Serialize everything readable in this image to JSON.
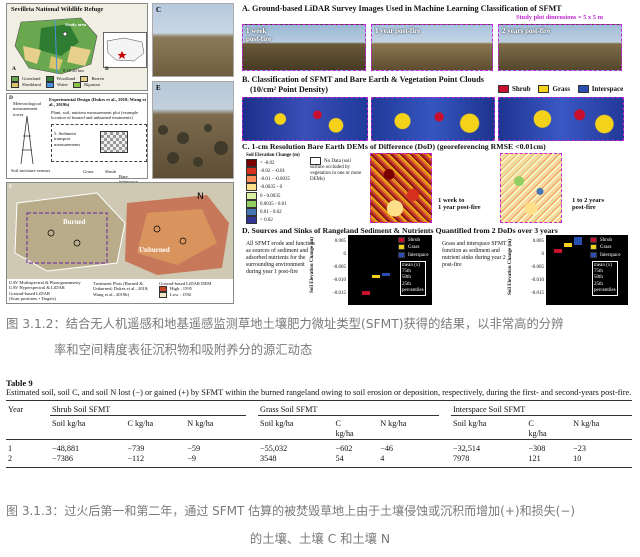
{
  "figure": {
    "map_panel": {
      "title": "Sevilleta National Wildlife Refuge",
      "labels": {
        "study_area": "Study area",
        "a": "A",
        "b": "B"
      },
      "legend": [
        "Grassland",
        "Woodland",
        "Barren",
        "Shrubland",
        "Water",
        "Riparian"
      ],
      "scale": "0   10   20 km",
      "scale2": "100  km"
    },
    "c_label": "C",
    "d_panel": {
      "label": "D",
      "met_tower": "Meteorological measurement tower",
      "design_title": "Experimental Design (Dukes et al., 2018; Wang et al., 2019b)",
      "plot_note": "Plant, soil, nutrient measurement plot (example location of burned and unburned treatments)",
      "sfmt_note": "5. Sediment transport measurements",
      "sensors": "Soil moisture sensors",
      "cats": [
        "Grass",
        "Shrub",
        "Bare interspace"
      ]
    },
    "e_label": "E",
    "f_panel": {
      "label": "F",
      "burned": "Burned",
      "unburned": "Unburned",
      "legend_left": [
        "UAV Multispectral & Photogrammetry",
        "UAV Hyperspectral & LiDAR",
        "Ground-based LiDAR",
        "(Scan positions • Targets)"
      ],
      "legend_mid": "Treatment Plots (Burned & Unburned; Dukes et al., 2018; Wang et al., 2019b)",
      "legend_right": "Ground-based LiDAR DEM",
      "high": "High : 1595",
      "low": "Low : 1592"
    },
    "section_a": {
      "title": "A.  Ground-based LiDAR Survey Images Used in Machine Learning Classification of SFMT",
      "study_plot": "Study plot dimensions = 5 x 5 m",
      "photos": [
        "1 week\npost-fire",
        "1 year post-fire",
        "2 years post-fire"
      ],
      "marker": "a"
    },
    "section_b": {
      "title": "B.  Classification of SFMT and Bare Earth & Vegetation Point Clouds",
      "subtitle": "(10/cm² Point Density)",
      "legend": [
        "Shrub",
        "Grass",
        "Interspace"
      ]
    },
    "section_c": {
      "title": "C.  1-cm Resolution Bare Earth DEMs of Difference (DoD) (georeferencing RMSE <0.01cm)",
      "legend_title": "Soil Elevation Change (m)",
      "legend": [
        "< -0.02",
        "-0.02 - -0.01",
        "-0.01 - -0.0035",
        "-0.0035 - 0",
        "0 - 0.0035",
        "0.0035 - 0.01",
        "0.01 - 0.02",
        "> 0.02"
      ],
      "no_data": "No Data (soil surface occluded by vegetation in one or more DEMs)",
      "dod1": "1 week to\n1 year post-fire",
      "dod2": "1 to 2 years\npost-fire"
    },
    "section_d": {
      "title": "D.  Sources and Sinks of Rangeland Sediment & Nutrients Quantified from 2 DoDs over 3 years",
      "text1": "All SFMT erode and function as sources of sediment and adsorbed nutrients for the surrounding environment during year 1 post-fire",
      "text2": "Grass and interspace SFMT function as sediment and nutrient sinks during year 2 post-fire",
      "ylabel": "Soil Elevation Change (m)",
      "yticks1": [
        "0.005",
        "0",
        "-0.005",
        "-0.010",
        "-0.015"
      ],
      "yticks2": [
        "0.005",
        "0",
        "-0.005",
        "-0.010",
        "-0.015"
      ],
      "legend": [
        "Shrub",
        "Grass",
        "Interspace"
      ],
      "stats": [
        "mean (x)",
        "75th",
        "50th",
        "25th",
        "percentiles"
      ]
    }
  },
  "caption1": {
    "line1": "图 3.1.2：结合无人机遥感和地基遥感监测草地土壤肥力微址类型(SFMT)获得的结果，以非常高的分辨",
    "line2": "率和空间精度表征沉积物和吸附养分的源汇动态"
  },
  "table": {
    "label": "Table 9",
    "description": "Estimated soil, soil C, and soil N lost (−) or gained (+) by SFMT within the burned rangeland owing to soil erosion or deposition, respectively, during the first- and second-years post-fire.",
    "col_year": "Year",
    "groups": [
      "Shrub Soil SFMT",
      "Grass Soil SFMT",
      "Interspace Soil SFMT"
    ],
    "subheaders": [
      "Soil kg/ha",
      "C kg/ha",
      "N kg/ha",
      "Soil kg/ha",
      "C",
      "N kg/ha",
      "Soil kg/ha",
      "C",
      "N kg/ha"
    ],
    "subheaders2": [
      "",
      "",
      "",
      "",
      "kg/ha",
      "",
      "",
      "kg/ha",
      ""
    ],
    "rows": [
      {
        "year": "1",
        "vals": [
          "−48,881",
          "−739",
          "−59",
          "−55,032",
          "−602",
          "−46",
          "−32,514",
          "−308",
          "−23"
        ]
      },
      {
        "year": "2",
        "vals": [
          "−7386",
          "−112",
          "−9",
          "3548",
          "54",
          "4",
          "7978",
          "121",
          "10"
        ]
      }
    ]
  },
  "caption2": {
    "line1": "图 3.1.3：过火后第一和第二年，通过 SFMT 估算的被焚毁草地上由于土壤侵蚀或沉积而增加(+)和损失(−)",
    "line2": "的土壤、土壤 C 和土壤 N"
  },
  "colors": {
    "shrub": "#c8102e",
    "grass": "#f4d21a",
    "interspace": "#2a4fb3",
    "purple_dash": "#c026d3",
    "caption": "#7a7a7a"
  }
}
